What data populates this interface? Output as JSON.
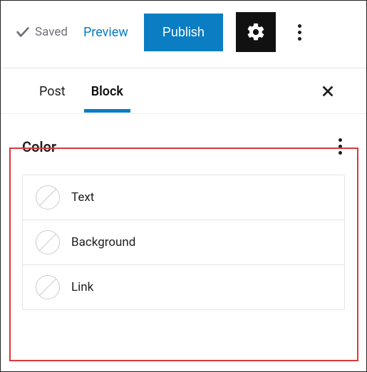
{
  "toolbar": {
    "saved_label": "Saved",
    "preview_label": "Preview",
    "publish_label": "Publish"
  },
  "tabs": {
    "post_label": "Post",
    "block_label": "Block",
    "active": "block"
  },
  "panel": {
    "title": "Color",
    "items": [
      {
        "label": "Text"
      },
      {
        "label": "Background"
      },
      {
        "label": "Link"
      }
    ]
  }
}
